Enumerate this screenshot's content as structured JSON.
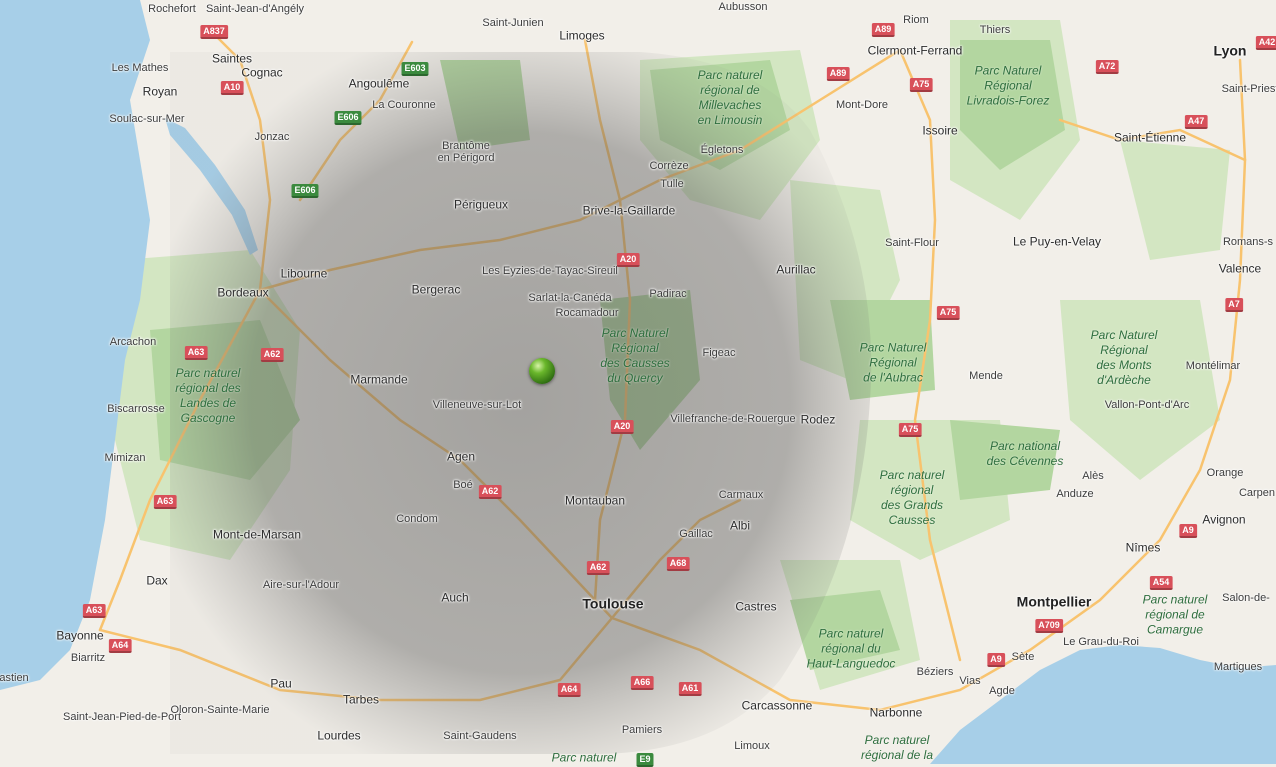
{
  "colors": {
    "land": "#f2efe9",
    "forest": "#c7e0b4",
    "park": "#a8cf92",
    "water": "#a7cfe8",
    "major_road": "#f8c36e",
    "overlay": "rgba(80,80,80,0.42)",
    "marker": "#4c9a1f"
  },
  "cities": [
    {
      "name": "Rochefort",
      "cls": ""
    },
    {
      "name": "Saint-Jean-d'Angély",
      "cls": ""
    },
    {
      "name": "Saint-Junien",
      "cls": ""
    },
    {
      "name": "Aubusson",
      "cls": ""
    },
    {
      "name": "Riom",
      "cls": ""
    },
    {
      "name": "Thiers",
      "cls": ""
    },
    {
      "name": "Lyon",
      "cls": "big"
    },
    {
      "name": "Saintes",
      "cls": "med"
    },
    {
      "name": "Cognac",
      "cls": "med"
    },
    {
      "name": "Angoulême",
      "cls": "med"
    },
    {
      "name": "Limoges",
      "cls": "med"
    },
    {
      "name": "Clermont-Ferrand",
      "cls": "med"
    },
    {
      "name": "Les Mathes",
      "cls": ""
    },
    {
      "name": "Royan",
      "cls": "med"
    },
    {
      "name": "La Couronne",
      "cls": ""
    },
    {
      "name": "Saint-Priest",
      "cls": ""
    },
    {
      "name": "Mont-Dore",
      "cls": ""
    },
    {
      "name": "Soulac-sur-Mer",
      "cls": ""
    },
    {
      "name": "Issoire",
      "cls": "med"
    },
    {
      "name": "Saint-Étienne",
      "cls": "med"
    },
    {
      "name": "Jonzac",
      "cls": ""
    },
    {
      "name": "Brantôme\nen Périgord",
      "cls": ""
    },
    {
      "name": "Corrèze",
      "cls": ""
    },
    {
      "name": "Égletons",
      "cls": ""
    },
    {
      "name": "Tulle",
      "cls": ""
    },
    {
      "name": "Périgueux",
      "cls": "med"
    },
    {
      "name": "Brive-la-Gaillarde",
      "cls": "med"
    },
    {
      "name": "Saint-Flour",
      "cls": ""
    },
    {
      "name": "Le Puy-en-Velay",
      "cls": "med"
    },
    {
      "name": "Romans-s",
      "cls": ""
    },
    {
      "name": "Libourne",
      "cls": "med"
    },
    {
      "name": "Les Eyzies-de-Tayac-Sireuil",
      "cls": ""
    },
    {
      "name": "Aurillac",
      "cls": "med"
    },
    {
      "name": "Valence",
      "cls": "med"
    },
    {
      "name": "Bordeaux",
      "cls": "med"
    },
    {
      "name": "Bergerac",
      "cls": "med"
    },
    {
      "name": "Sarlat-la-Canéda",
      "cls": ""
    },
    {
      "name": "Padirac",
      "cls": ""
    },
    {
      "name": "Rocamadour",
      "cls": ""
    },
    {
      "name": "Arcachon",
      "cls": ""
    },
    {
      "name": "Figeac",
      "cls": ""
    },
    {
      "name": "Montélimar",
      "cls": ""
    },
    {
      "name": "Marmande",
      "cls": "med"
    },
    {
      "name": "Mende",
      "cls": ""
    },
    {
      "name": "Biscarrosse",
      "cls": ""
    },
    {
      "name": "Villeneuve-sur-Lot",
      "cls": ""
    },
    {
      "name": "Villefranche-de-Rouergue",
      "cls": ""
    },
    {
      "name": "Rodez",
      "cls": "med"
    },
    {
      "name": "Vallon-Pont-d'Arc",
      "cls": ""
    },
    {
      "name": "Mimizan",
      "cls": ""
    },
    {
      "name": "Agen",
      "cls": "med"
    },
    {
      "name": "Boé",
      "cls": ""
    },
    {
      "name": "Alès",
      "cls": ""
    },
    {
      "name": "Orange",
      "cls": ""
    },
    {
      "name": "Anduze",
      "cls": ""
    },
    {
      "name": "Carpen",
      "cls": ""
    },
    {
      "name": "Montauban",
      "cls": "med"
    },
    {
      "name": "Carmaux",
      "cls": ""
    },
    {
      "name": "Condom",
      "cls": ""
    },
    {
      "name": "Albi",
      "cls": "med"
    },
    {
      "name": "Avignon",
      "cls": "med"
    },
    {
      "name": "Mont-de-Marsan",
      "cls": "med"
    },
    {
      "name": "Gaillac",
      "cls": ""
    },
    {
      "name": "Nîmes",
      "cls": "med"
    },
    {
      "name": "Dax",
      "cls": "med"
    },
    {
      "name": "Aire-sur-l'Adour",
      "cls": ""
    },
    {
      "name": "Auch",
      "cls": "med"
    },
    {
      "name": "Salon-de-",
      "cls": ""
    },
    {
      "name": "Toulouse",
      "cls": "big"
    },
    {
      "name": "Castres",
      "cls": "med"
    },
    {
      "name": "Montpellier",
      "cls": "big"
    },
    {
      "name": "Bayonne",
      "cls": "med"
    },
    {
      "name": "Biarritz",
      "cls": ""
    },
    {
      "name": "Le Grau-du-Roi",
      "cls": ""
    },
    {
      "name": "Sète",
      "cls": ""
    },
    {
      "name": "Béziers",
      "cls": ""
    },
    {
      "name": "Martigues",
      "cls": ""
    },
    {
      "name": "astien",
      "cls": ""
    },
    {
      "name": "Pau",
      "cls": "med"
    },
    {
      "name": "Vias",
      "cls": ""
    },
    {
      "name": "Agde",
      "cls": ""
    },
    {
      "name": "Saint-Jean-Pied-de-Port",
      "cls": ""
    },
    {
      "name": "Oloron-Sainte-Marie",
      "cls": ""
    },
    {
      "name": "Tarbes",
      "cls": "med"
    },
    {
      "name": "Carcassonne",
      "cls": "med"
    },
    {
      "name": "Narbonne",
      "cls": "med"
    },
    {
      "name": "Lourdes",
      "cls": "med"
    },
    {
      "name": "Saint-Gaudens",
      "cls": ""
    },
    {
      "name": "Pamiers",
      "cls": ""
    },
    {
      "name": "Limoux",
      "cls": ""
    }
  ],
  "parks": [
    "Parc naturel\nrégional de\nMillevaches\nen Limousin",
    "Parc Naturel\nRégional\nLivradois-Forez",
    "Parc Naturel\nRégional\ndes Causses\ndu Quercy",
    "Parc naturel\nrégional des\nLandes de\nGascogne",
    "Parc Naturel\nRégional\nde l'Aubrac",
    "Parc Naturel\nRégional\ndes Monts\nd'Ardèche",
    "Parc national\ndes Cévennes",
    "Parc naturel\nrégional\ndes Grands\nCausses",
    "Parc naturel\nrégional du\nHaut-Languedoc",
    "Parc naturel\nrégional de\nCamargue",
    "Parc naturel",
    "Parc naturel\nrégional de la"
  ],
  "roads": [
    "A837",
    "E603",
    "A89",
    "A42",
    "A10",
    "A72",
    "E606",
    "A75",
    "A47",
    "E606",
    "A89",
    "A20",
    "A7",
    "A75",
    "A63",
    "A62",
    "A20",
    "A75",
    "A62",
    "A9",
    "A63",
    "A68",
    "A54",
    "A62",
    "A63",
    "A709",
    "A64",
    "A9",
    "A64",
    "A66",
    "A61",
    "E9"
  ]
}
